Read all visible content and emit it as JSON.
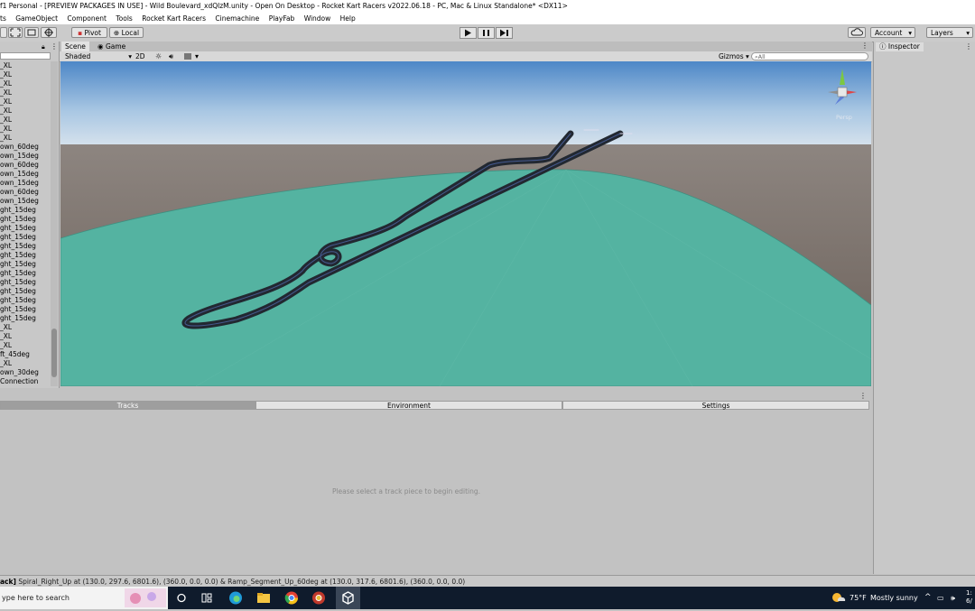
{
  "window": {
    "title": "f1 Personal - [PREVIEW PACKAGES IN USE] - Wild Boulevard_xdQlzM.unity - Open On Desktop - Rocket Kart Racers v2022.06.18 - PC, Mac & Linux Standalone* <DX11>"
  },
  "menu": [
    "ts",
    "GameObject",
    "Component",
    "Tools",
    "Rocket Kart Racers",
    "Cinemachine",
    "PlayFab",
    "Window",
    "Help"
  ],
  "toolbar": {
    "pivot_label": "Pivot",
    "local_label": "Local",
    "account_label": "Account",
    "layers_label": "Layers"
  },
  "hierarchy": {
    "items": [
      "_XL",
      "_XL",
      "_XL",
      "_XL",
      "_XL",
      "_XL",
      "_XL",
      "_XL",
      "_XL",
      "own_60deg",
      "own_15deg",
      "own_60deg",
      "own_15deg",
      "own_15deg",
      "own_60deg",
      "own_15deg",
      "ght_15deg",
      "ght_15deg",
      "ght_15deg",
      "ght_15deg",
      "ght_15deg",
      "ght_15deg",
      "ght_15deg",
      "ght_15deg",
      "ght_15deg",
      "ght_15deg",
      "ght_15deg",
      "ght_15deg",
      "ght_15deg",
      "_XL",
      "_XL",
      "_XL",
      "ft_45deg",
      "_XL",
      "own_30deg",
      "Connection"
    ]
  },
  "scene": {
    "tabs": [
      "Scene",
      "Game"
    ],
    "shading_mode": "Shaded",
    "mode_2d": "2D",
    "gizmos_label": "Gizmos",
    "search_placeholder": "All",
    "persp_label": "Persp"
  },
  "inspector": {
    "tab_label": "Inspector"
  },
  "track_editor": {
    "tabs": [
      "Tracks",
      "Environment",
      "Settings"
    ],
    "empty_message": "Please select a track piece to begin editing."
  },
  "status": {
    "prefix": "ack]",
    "message": "Spiral_Right_Up at (130.0, 297.6, 6801.6), (360.0, 0.0, 0.0) & Ramp_Segment_Up_60deg at (130.0, 317.6, 6801.6), (360.0, 0.0, 0.0)"
  },
  "taskbar": {
    "search_text": "ype here to search",
    "weather_temp": "75°F",
    "weather_desc": "Mostly sunny",
    "clock_top": "1:",
    "clock_bottom": "6/"
  },
  "colors": {
    "ground": "#54b3a1",
    "far_plane": "#6e625c",
    "sky_top": "#4d87c7",
    "track": "#222831"
  }
}
